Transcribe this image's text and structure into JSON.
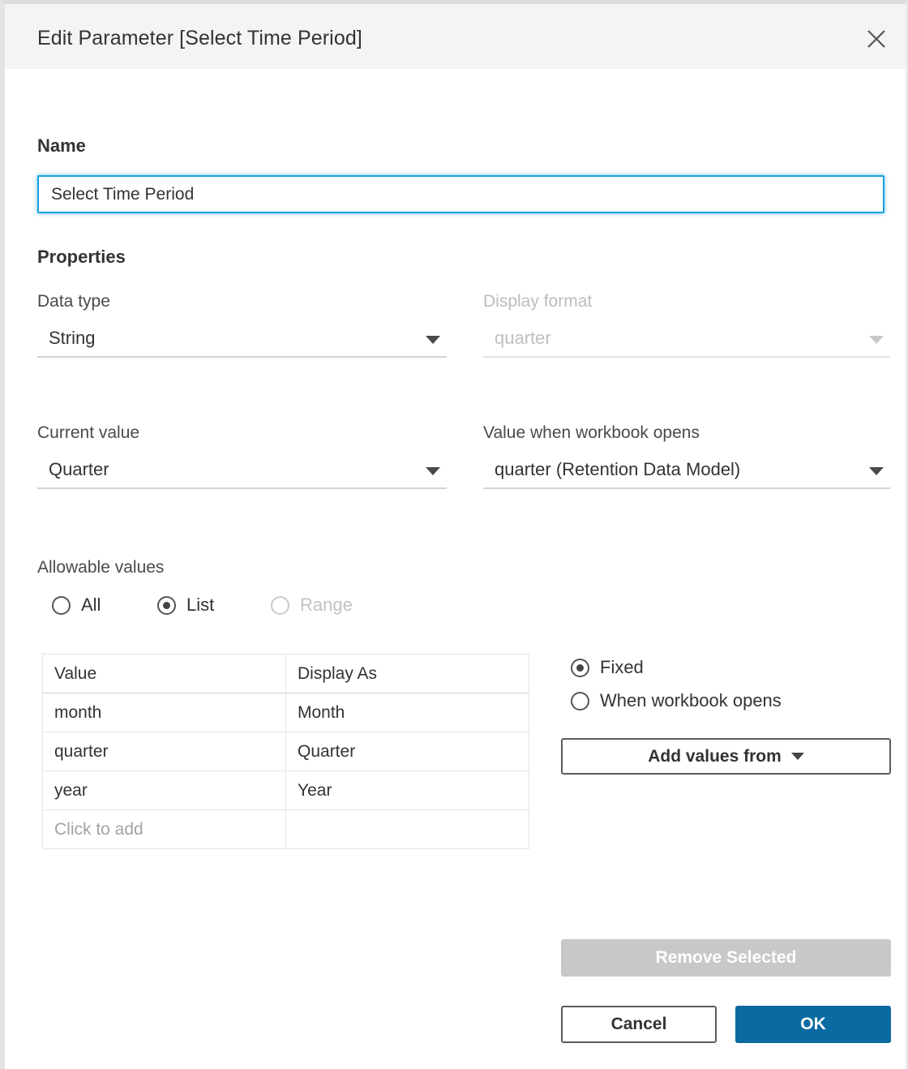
{
  "dialog": {
    "title": "Edit Parameter [Select Time Period]",
    "close_icon": "close-icon"
  },
  "name_section": {
    "label": "Name",
    "value": "Select Time Period",
    "placeholder": "Name"
  },
  "properties": {
    "heading": "Properties",
    "data_type": {
      "label": "Data type",
      "value": "String"
    },
    "display_format": {
      "label": "Display format",
      "value": "quarter",
      "disabled": true
    },
    "current_value": {
      "label": "Current value",
      "value": "Quarter"
    },
    "value_on_open": {
      "label": "Value when workbook opens",
      "value": "quarter (Retention Data Model)"
    }
  },
  "allowable_values": {
    "label": "Allowable values",
    "options": [
      {
        "label": "All",
        "selected": false,
        "disabled": false
      },
      {
        "label": "List",
        "selected": true,
        "disabled": false
      },
      {
        "label": "Range",
        "selected": false,
        "disabled": true
      }
    ]
  },
  "values_table": {
    "columns": [
      "Value",
      "Display As"
    ],
    "rows": [
      {
        "value": "month",
        "display_as": "Month"
      },
      {
        "value": "quarter",
        "display_as": "Quarter"
      },
      {
        "value": "year",
        "display_as": "Year"
      }
    ],
    "add_row_placeholder": "Click to add"
  },
  "list_source": {
    "options": [
      {
        "label": "Fixed",
        "selected": true
      },
      {
        "label": "When workbook opens",
        "selected": false
      }
    ],
    "add_values_button": "Add values from"
  },
  "footer": {
    "remove_selected": "Remove Selected",
    "cancel": "Cancel",
    "ok": "OK"
  },
  "colors": {
    "accent_blue": "#0a6ba1",
    "focus_blue": "#1ba0e1",
    "header_bg": "#f4f4f4",
    "disabled_gray": "#c8c8c8"
  }
}
